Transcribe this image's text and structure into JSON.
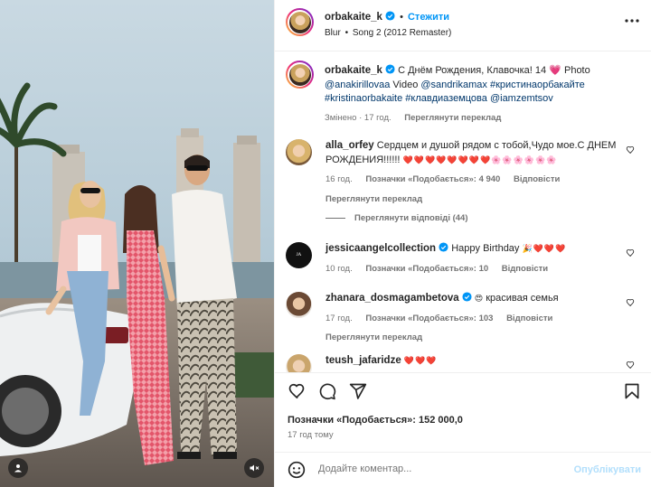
{
  "post": {
    "author": "orbakaite_k",
    "follow_label": "Стежити",
    "dot": "•",
    "music_artist": "Blur",
    "music_sep": "•",
    "music_track": "Song 2 (2012 Remaster)"
  },
  "caption": {
    "author": "orbakaite_k",
    "text": "С Днём Рождения, Клавочка! 14",
    "heart": "💗",
    "photo_label": "Photo",
    "photo_mention": "@anakirillovaa",
    "video_label": "Video",
    "video_mention": "@sandrikamax",
    "tag1": "#кристинаорбакайте",
    "tag2": "#kristinaorbakaite",
    "tag3": "#клавдиyaземцова",
    "tag3_display": "#клавдиаземцова",
    "mention3": "@iamzemtsov",
    "edited": "Змінено",
    "time": "17 год.",
    "translate": "Переглянути переклад"
  },
  "comments": [
    {
      "user": "alla_orfey",
      "text": "Сердцем и душой рядом с тобой,Чудо мое.С ДНЕМ РОЖДЕНИЯ!!!!!!",
      "emojis": "❤️❤️❤️❤️❤️❤️❤️❤️🌸🌸🌸🌸🌸🌸",
      "time": "16 год.",
      "likes": "Позначки «Подобається»: 4 940",
      "reply": "Відповісти",
      "translate": "Переглянути переклад",
      "replies": "Переглянути відповіді (44)"
    },
    {
      "user": "jessicaangelcollection",
      "text": "Happy Birthday",
      "emojis": "🎉❤️❤️❤️",
      "time": "10 год.",
      "likes": "Позначки «Подобається»: 10",
      "reply": "Відповісти"
    },
    {
      "user": "zhanara_dosmagambetova",
      "text": "красивая семья",
      "emojis_pre": "😍",
      "time": "17 год.",
      "likes": "Позначки «Подобається»: 103",
      "reply": "Відповісти",
      "translate": "Переглянути переклад"
    },
    {
      "user": "teush_jafaridze",
      "emojis": "❤️❤️❤️"
    }
  ],
  "actions": {
    "likes": "Позначки «Подобається»: 152 000,0",
    "time": "17 год тому"
  },
  "composer": {
    "placeholder": "Додайте коментар...",
    "post_label": "Опублікувати"
  },
  "colors": {
    "accent": "#0095f6",
    "verified": "#0095f6",
    "link": "#00376b",
    "muted": "#737373",
    "post_disabled": "#b2dffc"
  },
  "icons": [
    "verified-badge-icon",
    "heart-icon",
    "comment-icon",
    "share-icon",
    "bookmark-icon",
    "emoji-icon",
    "mute-icon",
    "tag-user-icon"
  ]
}
